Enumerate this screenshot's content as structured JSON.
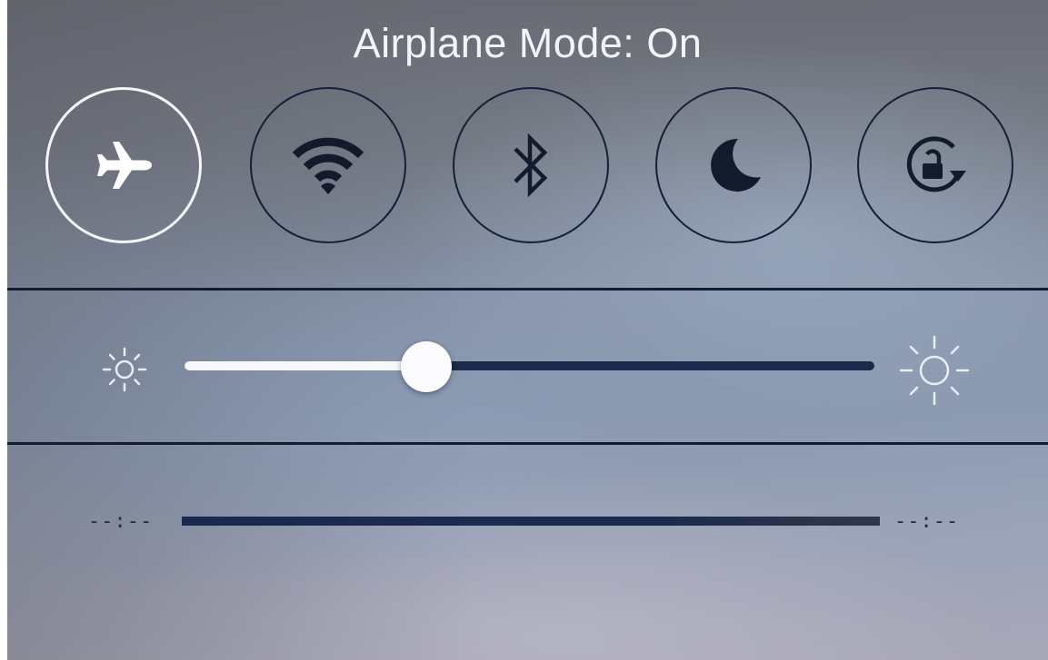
{
  "status": {
    "title": "Airplane Mode: On"
  },
  "toggles": [
    {
      "name": "airplane-mode",
      "icon": "airplane-icon",
      "state": "on"
    },
    {
      "name": "wifi",
      "icon": "wifi-icon",
      "state": "off"
    },
    {
      "name": "bluetooth",
      "icon": "bluetooth-icon",
      "state": "off"
    },
    {
      "name": "do-not-disturb",
      "icon": "moon-icon",
      "state": "off"
    },
    {
      "name": "rotation-lock",
      "icon": "rotation-lock-icon",
      "state": "off"
    }
  ],
  "brightness": {
    "min_icon": "sun-small-icon",
    "max_icon": "sun-large-icon",
    "level": 0.35
  },
  "media": {
    "elapsed": "--:--",
    "remaining": "--:--",
    "progress": 0
  },
  "colors": {
    "active_ring": "#f6f6f8",
    "inactive_ring": "#14203a",
    "track_filled": "#f7f8fb",
    "track_empty": "#1b2a4c"
  }
}
